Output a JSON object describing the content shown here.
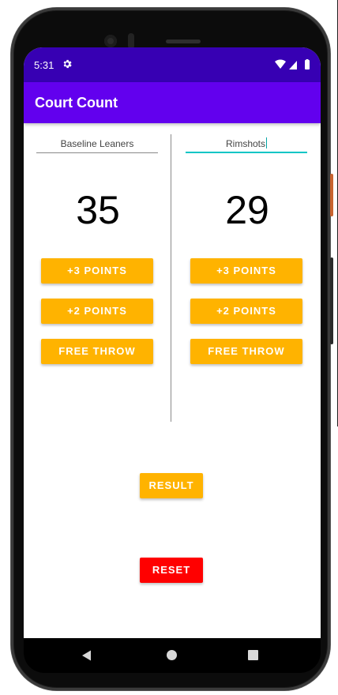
{
  "status_bar": {
    "time": "5:31",
    "settings_icon": "gear-icon",
    "wifi_icon": "wifi-icon",
    "signal_icon": "signal-icon",
    "battery_icon": "battery-icon"
  },
  "app_bar": {
    "title": "Court Count"
  },
  "team_a": {
    "name": "Baseline Leaners",
    "score": "35",
    "buttons": {
      "three": "+3 POINTS",
      "two": "+2 POINTS",
      "free": "FREE THROW"
    }
  },
  "team_b": {
    "name": "Rimshots",
    "score": "29",
    "buttons": {
      "three": "+3 POINTS",
      "two": "+2 POINTS",
      "free": "FREE THROW"
    }
  },
  "actions": {
    "result": "RESULT",
    "reset": "RESET"
  },
  "colors": {
    "status_bar": "#3700b3",
    "app_bar": "#6200ee",
    "button": "#ffb300",
    "reset": "#ff0000",
    "focus_underline": "#03c5c5"
  }
}
